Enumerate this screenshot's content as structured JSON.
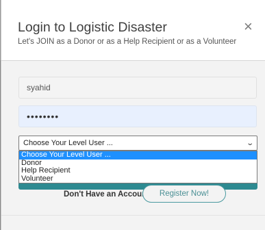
{
  "modal": {
    "title": "Login to Logistic Disaster",
    "subtitle": "Let's JOIN as a Donor or as a Help Recipient or as a Volunteer",
    "close_glyph": "×"
  },
  "form": {
    "username_value": "syahid",
    "password_value": "••••••••",
    "level_select": {
      "selected": "Choose Your Level User ...",
      "options": [
        "Choose Your Level User ...",
        "Donor",
        "Help Recipient",
        "Volunteer"
      ]
    }
  },
  "footer": {
    "prompt": "Don't Have an Account?",
    "register_label": "Register Now!"
  },
  "colors": {
    "accent": "#2e8a91",
    "selected_option": "#1e90ff",
    "password_autofill_bg": "#e8f0fe"
  }
}
